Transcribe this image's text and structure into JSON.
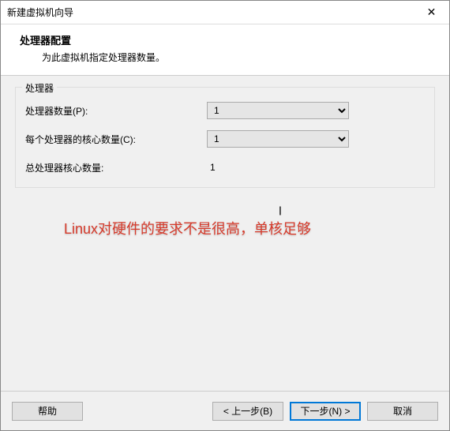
{
  "window": {
    "title": "新建虚拟机向导"
  },
  "header": {
    "title": "处理器配置",
    "subtitle": "为此虚拟机指定处理器数量。"
  },
  "group": {
    "legend": "处理器",
    "rows": {
      "processors": {
        "label": "处理器数量(P):",
        "value": "1"
      },
      "cores": {
        "label": "每个处理器的核心数量(C):",
        "value": "1"
      },
      "total": {
        "label": "总处理器核心数量:",
        "value": "1"
      }
    }
  },
  "annotation": "Linux对硬件的要求不是很高，单核足够",
  "buttons": {
    "help": "帮助",
    "back": "< 上一步(B)",
    "next": "下一步(N) >",
    "cancel": "取消"
  }
}
